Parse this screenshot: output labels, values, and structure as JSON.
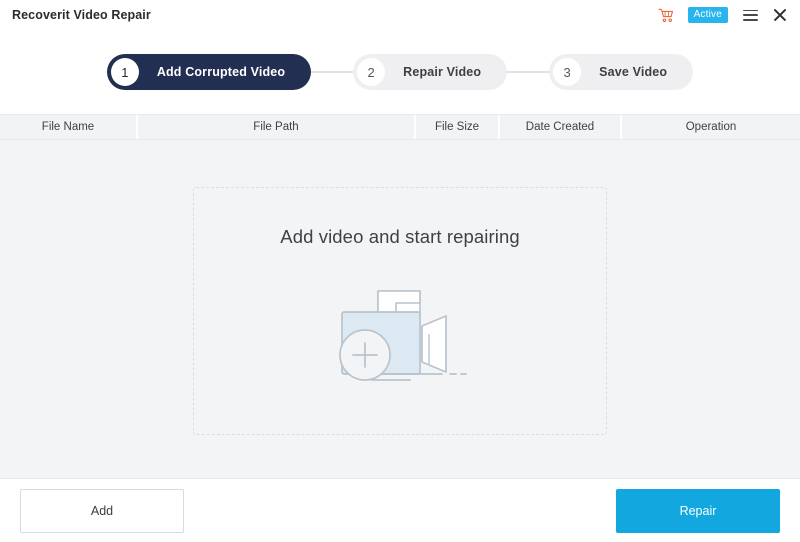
{
  "window": {
    "title": "Recoverit Video Repair",
    "controls": {
      "cart_icon": "shopping-cart-icon",
      "active_badge": "Active",
      "menu_icon": "hamburger-menu-icon",
      "close_icon": "close-icon"
    }
  },
  "stepper": {
    "steps": [
      {
        "number": "1",
        "label": "Add Corrupted Video",
        "state": "active"
      },
      {
        "number": "2",
        "label": "Repair Video",
        "state": "inactive"
      },
      {
        "number": "3",
        "label": "Save Video",
        "state": "inactive"
      }
    ]
  },
  "table": {
    "columns": [
      {
        "label": "File Name"
      },
      {
        "label": "File Path"
      },
      {
        "label": "File Size"
      },
      {
        "label": "Date Created"
      },
      {
        "label": "Operation"
      }
    ],
    "rows": []
  },
  "dropzone": {
    "title": "Add video and start repairing",
    "illustration": "video-camera-add-icon"
  },
  "footer": {
    "add_label": "Add",
    "repair_label": "Repair"
  },
  "colors": {
    "accent": "#12A8DF",
    "step_active": "#232F52",
    "step_inactive": "#EFEFF1",
    "badge": "#28B4EC",
    "cart": "#E8663C",
    "content_bg": "#F3F4F5",
    "dropzone_border": "#CFE0EE",
    "illustration_stroke": "#B8C3CC",
    "illustration_fill": "#DCE9F3"
  }
}
